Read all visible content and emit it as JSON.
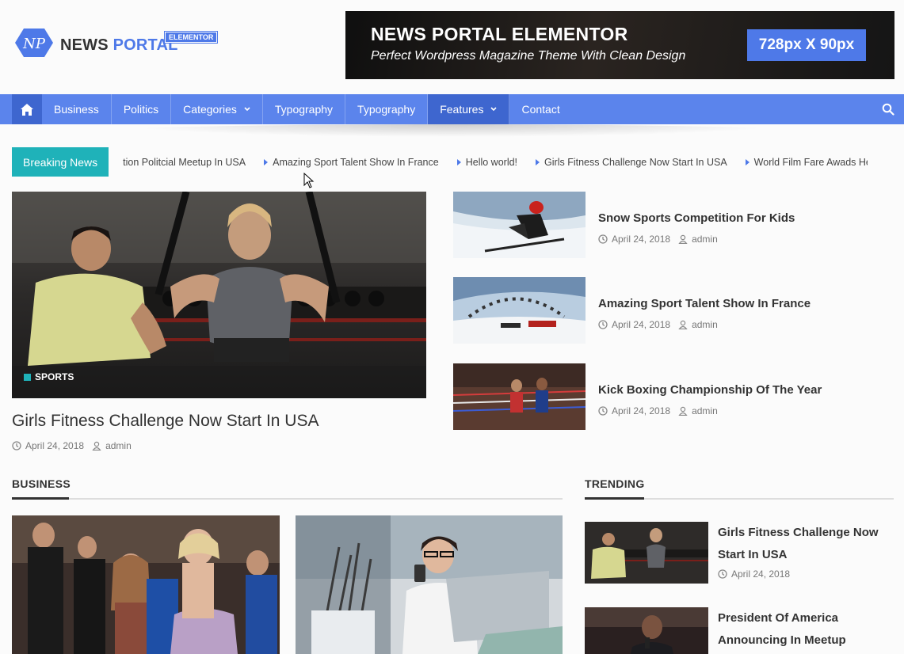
{
  "logo": {
    "word1": "NEWS",
    "word2": "PORTAL",
    "badge": "ELEMENTOR",
    "mark": "NP"
  },
  "banner": {
    "title": "NEWS PORTAL ELEMENTOR",
    "subtitle": "Perfect Wordpress Magazine Theme With Clean Design",
    "size_label": "728px X 90px"
  },
  "nav": {
    "items": [
      {
        "label": "Business"
      },
      {
        "label": "Politics"
      },
      {
        "label": "Categories"
      },
      {
        "label": "Typography"
      },
      {
        "label": "Typography"
      },
      {
        "label": "Features"
      },
      {
        "label": "Contact"
      }
    ]
  },
  "breaking": {
    "label": "Breaking News",
    "items": [
      "tion Politcial Meetup In USA",
      "Amazing Sport Talent Show In France",
      "Hello world!",
      "Girls Fitness Challenge Now Start In USA",
      "World Film Fare Awads Held In P"
    ]
  },
  "featured": {
    "category": "SPORTS",
    "title": "Girls Fitness Challenge Now Start In USA",
    "date": "April 24, 2018",
    "author": "admin"
  },
  "side_posts": [
    {
      "title": "Snow Sports Competition For Kids",
      "date": "April 24, 2018",
      "author": "admin"
    },
    {
      "title": "Amazing Sport Talent Show In France",
      "date": "April 24, 2018",
      "author": "admin"
    },
    {
      "title": "Kick Boxing Championship Of The Year",
      "date": "April 24, 2018",
      "author": "admin"
    }
  ],
  "business": {
    "heading": "BUSINESS"
  },
  "trending": {
    "heading": "TRENDING",
    "items": [
      {
        "title": "Girls Fitness Challenge Now Start In USA",
        "date": "April 24, 2018"
      },
      {
        "title": "President Of America Announcing In Meetup",
        "date": ""
      }
    ]
  },
  "colors": {
    "accent": "#5b84ec",
    "accent_dark": "#3e66cf",
    "teal": "#1fb2b9"
  }
}
